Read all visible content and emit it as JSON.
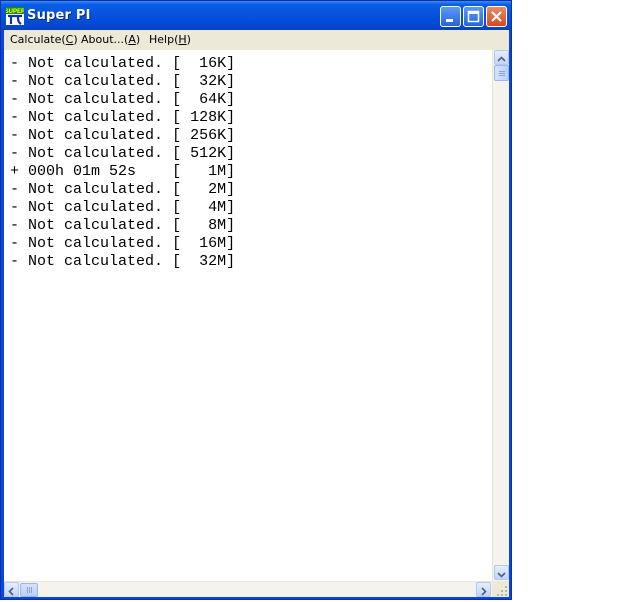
{
  "window": {
    "title": "Super PI",
    "app_icon_name": "super-pi-icon"
  },
  "titlebar_buttons": {
    "minimize_icon": "minimize-icon",
    "maximize_icon": "maximize-icon",
    "close_icon": "close-icon"
  },
  "menu": [
    {
      "label": "Calculate(",
      "accel": "C",
      "tail": ")"
    },
    {
      "label": "About...(",
      "accel": "A",
      "tail": ")"
    },
    {
      "label": "Help(",
      "accel": "H",
      "tail": ")"
    }
  ],
  "results": [
    {
      "status": "-",
      "text": "Not calculated.",
      "size": "16K"
    },
    {
      "status": "-",
      "text": "Not calculated.",
      "size": "32K"
    },
    {
      "status": "-",
      "text": "Not calculated.",
      "size": "64K"
    },
    {
      "status": "-",
      "text": "Not calculated.",
      "size": "128K"
    },
    {
      "status": "-",
      "text": "Not calculated.",
      "size": "256K"
    },
    {
      "status": "-",
      "text": "Not calculated.",
      "size": "512K"
    },
    {
      "status": "+",
      "text": "000h 01m 52s",
      "size": "1M"
    },
    {
      "status": "-",
      "text": "Not calculated.",
      "size": "2M"
    },
    {
      "status": "-",
      "text": "Not calculated.",
      "size": "4M"
    },
    {
      "status": "-",
      "text": "Not calculated.",
      "size": "8M"
    },
    {
      "status": "-",
      "text": "Not calculated.",
      "size": "16M"
    },
    {
      "status": "-",
      "text": "Not calculated.",
      "size": "32M"
    }
  ],
  "colors": {
    "title_bar": "#0553e0",
    "close_button": "#d5491f",
    "menu_bg": "#ece9d8"
  }
}
